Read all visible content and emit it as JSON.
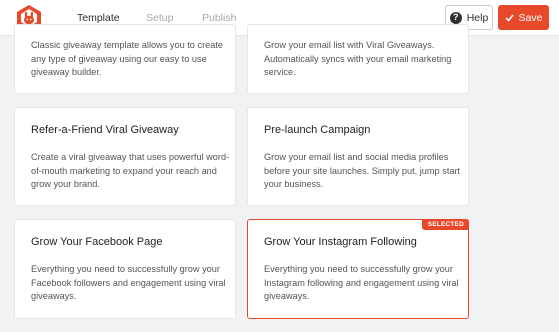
{
  "header": {
    "tabs": [
      {
        "label": "Template",
        "active": true
      },
      {
        "label": "Setup",
        "active": false
      },
      {
        "label": "Publish",
        "active": false
      }
    ],
    "help_label": "Help",
    "save_label": "Save"
  },
  "colors": {
    "accent": "#e8492a",
    "background": "#f1f2f4",
    "card": "#ffffff"
  },
  "cards": [
    {
      "title": "",
      "description": "Classic giveaway template allows you to create any type of giveaway using our easy to use giveaway builder.",
      "selected": false
    },
    {
      "title": "",
      "description": "Grow your email list with Viral Giveaways. Automatically syncs with your email marketing service.",
      "selected": false
    },
    {
      "title": "Refer-a-Friend Viral Giveaway",
      "description": "Create a viral giveaway that uses powerful word-of-mouth marketing to expand your reach and grow your brand.",
      "selected": false
    },
    {
      "title": "Pre-launch Campaign",
      "description": "Grow your email list and social media profiles before your site launches. Simply put, jump start your business.",
      "selected": false
    },
    {
      "title": "Grow Your Facebook Page",
      "description": "Everything you need to successfully grow your Facebook followers and engagement using viral giveaways.",
      "selected": false
    },
    {
      "title": "Grow Your Instagram Following",
      "description": "Everything you need to successfully grow your Instagram following and engagement using viral giveaways.",
      "selected": true,
      "badge": "SELECTED"
    }
  ]
}
